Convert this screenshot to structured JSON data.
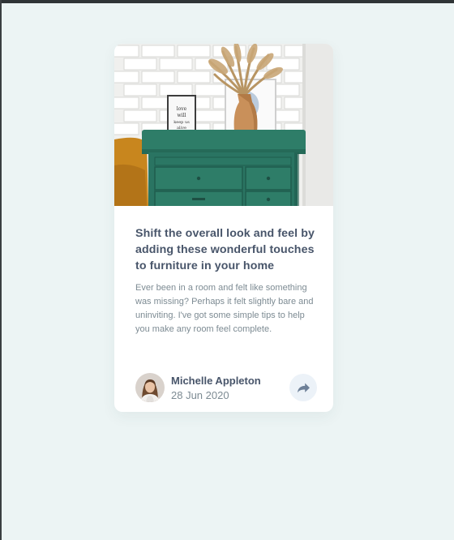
{
  "card": {
    "title": "Shift the overall look and feel by adding these wonderful touches to furniture in your home",
    "description": "Ever been in a room and felt like something was missing? Perhaps it felt slightly bare and uninviting. I've got some simple tips to help you make any room feel complete.",
    "author": {
      "name": "Michelle Appleton",
      "date": "28 Jun 2020"
    },
    "share_icon": "share-arrow-icon",
    "hero_icon": "drawers-photo"
  },
  "colors": {
    "page_background": "#ecf4f4",
    "title_text": "#48556a",
    "body_text": "#7d8b93",
    "share_button_bg": "#ecf2f8",
    "share_icon": "#6e8098",
    "dresser_green": "#2d7a66"
  }
}
